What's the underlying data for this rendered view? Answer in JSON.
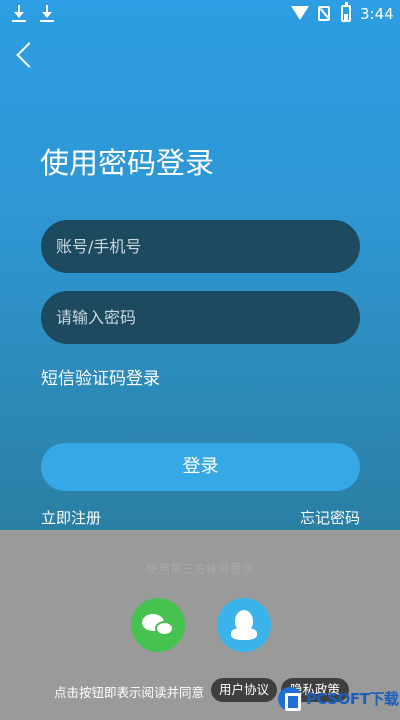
{
  "status_bar": {
    "time": "3:44",
    "icons": [
      "download-icon",
      "download-icon",
      "wifi-icon",
      "no-sim-icon",
      "battery-icon"
    ]
  },
  "header": {
    "back_icon": "chevron-left-icon",
    "title": "使用密码登录"
  },
  "form": {
    "account_placeholder": "账号/手机号",
    "password_placeholder": "请输入密码",
    "sms_login": "短信验证码登录",
    "login_button": "登录",
    "register": "立即注册",
    "forgot_password": "忘记密码"
  },
  "third_party": {
    "label": "使用第三方帐号登录",
    "options": [
      {
        "name": "WeChat",
        "icon": "wechat-icon",
        "color": "#45c24f"
      },
      {
        "name": "QQ",
        "icon": "qq-icon",
        "color": "#3ab3ea"
      }
    ]
  },
  "agreement": {
    "text": "点击按钮即表示阅读并同意",
    "user_agreement": "用户协议",
    "privacy_policy": "隐私政策"
  },
  "watermark": {
    "text": "PCSOFT下载"
  },
  "colors": {
    "primary": "#36a8e6",
    "input_bg": "#1e4a5f",
    "bottom_bg": "#9a9a9a"
  }
}
